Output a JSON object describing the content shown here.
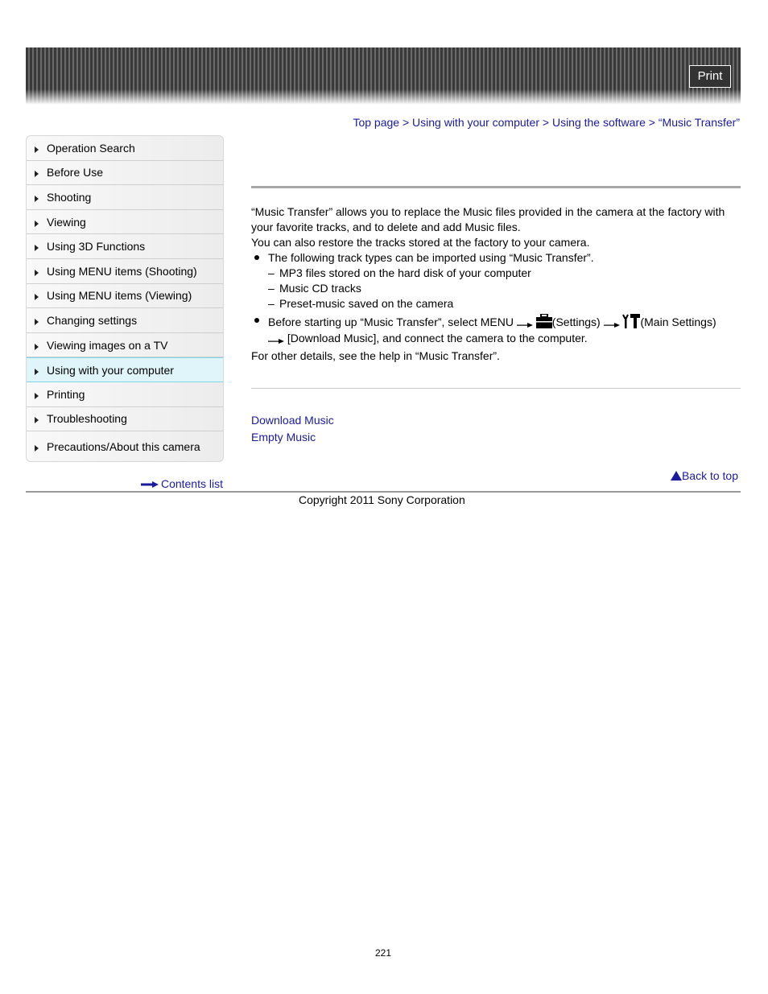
{
  "header": {
    "print_label": "Print"
  },
  "breadcrumb": {
    "items": [
      "Top page",
      "Using with your computer",
      "Using the software",
      "“Music Transfer”"
    ],
    "separator": ">"
  },
  "sidebar": {
    "items": [
      {
        "label": "Operation Search"
      },
      {
        "label": "Before Use"
      },
      {
        "label": "Shooting"
      },
      {
        "label": "Viewing"
      },
      {
        "label": "Using 3D Functions"
      },
      {
        "label": "Using MENU items (Shooting)"
      },
      {
        "label": "Using MENU items (Viewing)"
      },
      {
        "label": "Changing settings"
      },
      {
        "label": "Viewing images on a TV"
      },
      {
        "label": "Using with your computer",
        "active": true
      },
      {
        "label": "Printing"
      },
      {
        "label": "Troubleshooting"
      },
      {
        "label": "Precautions/About this camera"
      }
    ],
    "contents_link": "Contents list"
  },
  "content": {
    "intro_1": "“Music Transfer” allows you to replace the Music files provided in the camera at the factory with your favorite tracks, and to delete and add Music files.",
    "intro_2": "You can also restore the tracks stored at the factory to your camera.",
    "bullet_1": "The following track types can be imported using “Music Transfer”.",
    "sub_items": [
      "MP3 files stored on the hard disk of your computer",
      "Music CD tracks",
      "Preset-music saved on the camera"
    ],
    "bullet_2_a": "Before starting up “Music Transfer”, select MENU",
    "bullet_2_settings": "(Settings)",
    "bullet_2_main": "(Main Settings)",
    "bullet_2_b": "[Download Music], and connect the camera to the computer.",
    "outro": "For other details, see the help in “Music Transfer”."
  },
  "related": {
    "links": [
      "Download Music",
      "Empty Music"
    ]
  },
  "footer": {
    "back_to_top": "Back to top",
    "copyright": "Copyright 2011 Sony Corporation",
    "page_number": "221"
  }
}
